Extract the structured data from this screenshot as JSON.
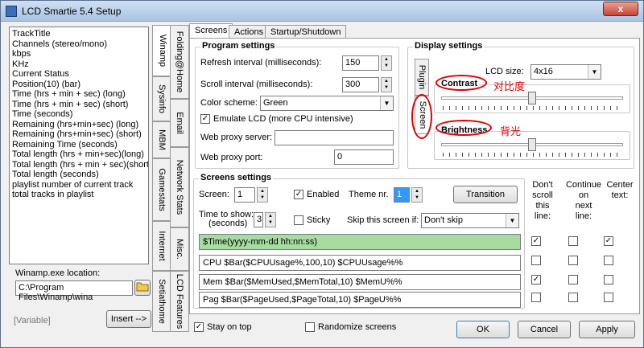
{
  "window": {
    "title": "LCD Smartie 5.4 Setup",
    "close_label": "x"
  },
  "left": {
    "items": [
      "TrackTitle",
      "Channels (stereo/mono)",
      "kbps",
      "KHz",
      "Current Status",
      "Position(10) (bar)",
      "Time (hrs + min + sec) (long)",
      "Time (hrs + min + sec) (short)",
      "Time (seconds)",
      "Remaining (hrs+min+sec) (long)",
      "Remaining (hrs+min+sec) (short)",
      "Remaining Time (seconds)",
      "Total length (hrs + min+sec)(long)",
      "Total length (hrs + min + sec)(short)",
      "Total length (seconds)",
      "playlist number of current track",
      "total tracks in playlist"
    ],
    "exe_label": "Winamp.exe location:",
    "exe_value": "C:\\Program Files\\Winamp\\wina",
    "variable_label": "[Variable]",
    "insert_label": "Insert -->"
  },
  "vtabs": {
    "col1": [
      "Winamp",
      "Sysinfo",
      "MBM",
      "Gamestats",
      "Internet",
      "Setiathome"
    ],
    "col2": [
      "Folding@Home",
      "Email",
      "Network Stats",
      "Misc.",
      "LCD Features"
    ]
  },
  "tabs": [
    "Screens",
    "Actions",
    "Startup/Shutdown"
  ],
  "program": {
    "legend": "Program settings",
    "refresh_label": "Refresh interval (milliseconds):",
    "refresh_value": "150",
    "scroll_label": "Scroll interval (milliseconds):",
    "scroll_value": "300",
    "color_label": "Color scheme:",
    "color_value": "Green",
    "emulate_label": "Emulate LCD  (more CPU intensive)",
    "proxy_server_label": "Web proxy server:",
    "proxy_server_value": "",
    "proxy_port_label": "Web proxy port:",
    "proxy_port_value": "0"
  },
  "display": {
    "legend": "Display settings",
    "vtab_plugin": "Plugin",
    "vtab_screen": "Screen",
    "lcd_size_label": "LCD size:",
    "lcd_size_value": "4x16",
    "contrast_label": "Contrast",
    "contrast_note": "对比度",
    "contrast_level": 0.5,
    "brightness_label": "Brightness",
    "brightness_note": "背光",
    "brightness_level": 0.5
  },
  "screens": {
    "legend": "Screens settings",
    "screen_label": "Screen:",
    "screen_value": "1",
    "enabled_label": "Enabled",
    "theme_label": "Theme nr.",
    "theme_value": "1",
    "transition_label": "Transition",
    "time_label_1": "Time to show:",
    "time_label_2": "(seconds)",
    "time_value": "3",
    "sticky_label": "Sticky",
    "skip_label": "Skip this screen if:",
    "skip_value": "Don't skip",
    "col_dont_scroll": [
      "Don't",
      "scroll",
      "this",
      "line:"
    ],
    "col_continue": [
      "Continue",
      "on",
      "next",
      "line:"
    ],
    "col_center": [
      "Center",
      "text:"
    ],
    "lines": [
      "$Time(yyyy-mm-dd hh:nn:ss)",
      "CPU $Bar($CPUUsage%,100,10) $CPUUsage%%",
      "Mem $Bar($MemUsed,$MemTotal,10) $MemU%%",
      "Pag $Bar($PageUsed,$PageTotal,10) $PageU%%"
    ],
    "line_highlight_color": "#a6dca0"
  },
  "footer": {
    "stay_on_top": "Stay on top",
    "randomize": "Randomize screens",
    "ok": "OK",
    "cancel": "Cancel",
    "apply": "Apply"
  },
  "colors": {
    "annotation": "#e00000"
  }
}
